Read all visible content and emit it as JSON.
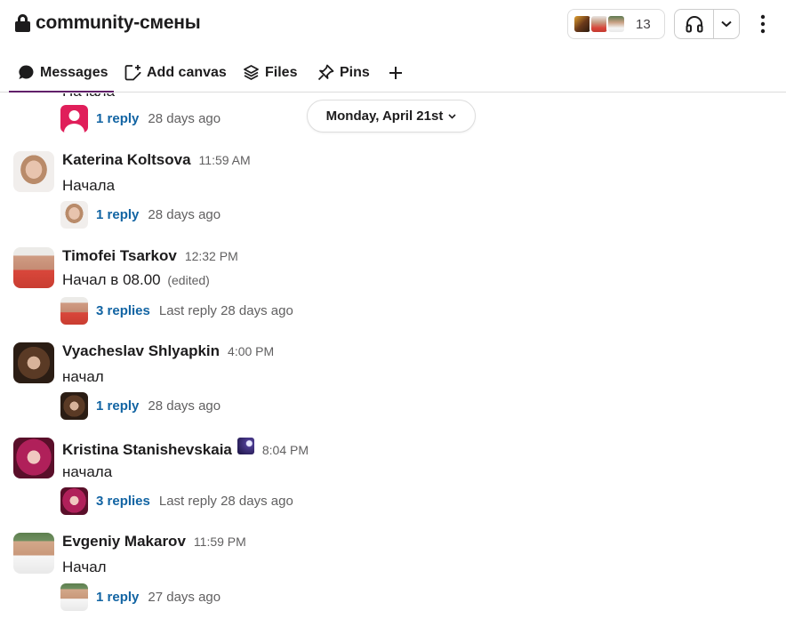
{
  "header": {
    "title": "community-смены",
    "member_count": "13"
  },
  "tabs": [
    {
      "label": "Messages",
      "icon": "message-bubble-icon",
      "active": true
    },
    {
      "label": "Add canvas",
      "icon": "add-canvas-icon"
    },
    {
      "label": "Files",
      "icon": "layers-icon"
    },
    {
      "label": "Pins",
      "icon": "pin-icon"
    },
    {
      "label": "+",
      "icon": "plus-icon"
    }
  ],
  "date_divider": "Monday, April 21st",
  "clipped_message": {
    "text": "Начала",
    "thread": {
      "replies": "1 reply",
      "last": "28 days ago"
    }
  },
  "messages": [
    {
      "name": "Katerina Koltsova",
      "time": "11:59 AM",
      "text": "Начала",
      "edited": "",
      "thread": {
        "replies": "1 reply",
        "last": "28 days ago"
      }
    },
    {
      "name": "Timofei Tsarkov",
      "time": "12:32 PM",
      "text": "Начал в 08.00",
      "edited": "(edited)",
      "thread": {
        "replies": "3 replies",
        "last": "Last reply 28 days ago"
      }
    },
    {
      "name": "Vyacheslav Shlyapkin",
      "time": "4:00 PM",
      "text": "начал",
      "edited": "",
      "thread": {
        "replies": "1 reply",
        "last": "28 days ago"
      }
    },
    {
      "name": "Kristina Stanishevskaia",
      "time": "8:04 PM",
      "text": "начала",
      "edited": "",
      "thread": {
        "replies": "3 replies",
        "last": "Last reply 28 days ago"
      }
    },
    {
      "name": "Evgeniy Makarov",
      "time": "11:59 PM",
      "text": "Начал",
      "edited": "",
      "thread": {
        "replies": "1 reply",
        "last": "27 days ago"
      }
    }
  ],
  "colors": {
    "accent": "#611f69",
    "link": "#1264a3",
    "muted": "#616061"
  }
}
